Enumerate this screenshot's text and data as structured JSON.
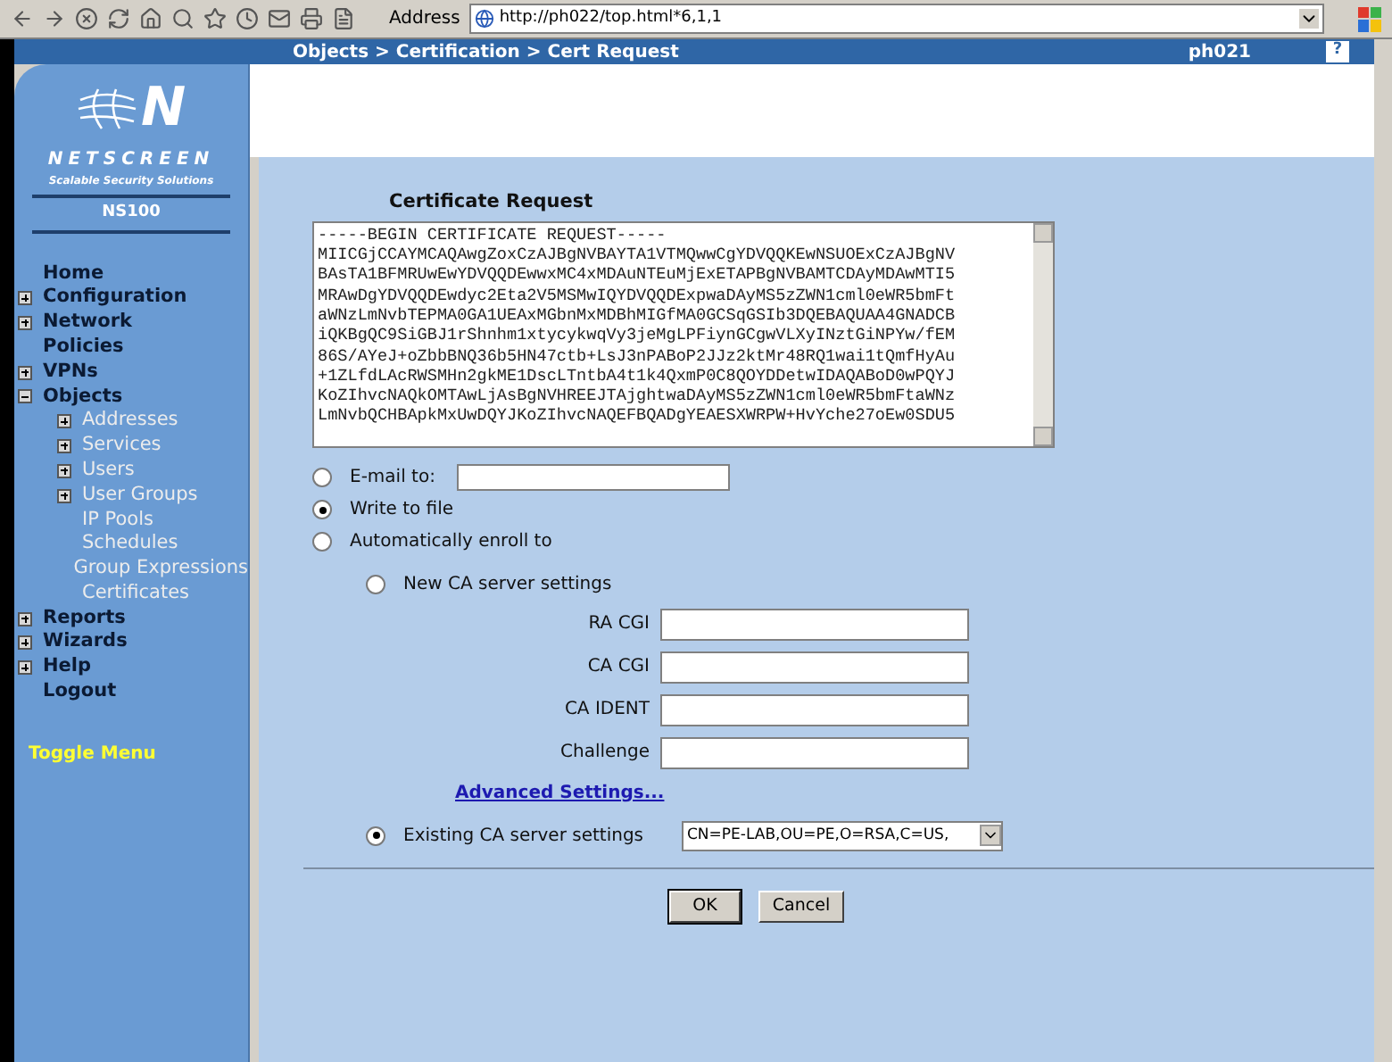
{
  "browser": {
    "address_label": "Address",
    "url": "http://ph022/top.html*6,1,1"
  },
  "header": {
    "breadcrumb": "Objects > Certification > Cert Request",
    "device": "ph021",
    "help": "?"
  },
  "sidebar": {
    "logo_mark": "N",
    "brand": "NETSCREEN",
    "tagline": "Scalable Security Solutions",
    "model": "NS100",
    "items": [
      {
        "label": "Home",
        "kind": "page"
      },
      {
        "label": "Configuration",
        "kind": "folder",
        "expanded": false
      },
      {
        "label": "Network",
        "kind": "folder",
        "expanded": false
      },
      {
        "label": "Policies",
        "kind": "page"
      },
      {
        "label": "VPNs",
        "kind": "folder",
        "expanded": false
      },
      {
        "label": "Objects",
        "kind": "folder",
        "expanded": true,
        "children": [
          {
            "label": "Addresses",
            "kind": "folder",
            "expanded": false
          },
          {
            "label": "Services",
            "kind": "folder",
            "expanded": false
          },
          {
            "label": "Users",
            "kind": "folder",
            "expanded": false
          },
          {
            "label": "User Groups",
            "kind": "folder",
            "expanded": false
          },
          {
            "label": "IP Pools",
            "kind": "page"
          },
          {
            "label": "Schedules",
            "kind": "page"
          },
          {
            "label": "Group Expressions",
            "kind": "page"
          },
          {
            "label": "Certificates",
            "kind": "page"
          }
        ]
      },
      {
        "label": "Reports",
        "kind": "folder",
        "expanded": false
      },
      {
        "label": "Wizards",
        "kind": "folder",
        "expanded": false
      },
      {
        "label": "Help",
        "kind": "folder",
        "expanded": false
      },
      {
        "label": "Logout",
        "kind": "page"
      }
    ],
    "toggle": "Toggle Menu"
  },
  "form": {
    "title": "Certificate Request",
    "request_lines": [
      "-----BEGIN CERTIFICATE REQUEST-----",
      "MIICGjCCAYMCAQAwgZoxCzAJBgNVBAYTA1VTMQwwCgYDVQQKEwNSUOExCzAJBgNV",
      "BAsTA1BFMRUwEwYDVQQDEwwxMC4xMDAuNTEuMjExETAPBgNVBAMTCDAyMDAwMTI5",
      "MRAwDgYDVQQDEwdyc2Eta2V5MSMwIQYDVQQDExpwaDAyMS5zZWN1cml0eWR5bmFt",
      "aWNzLmNvbTEPMA0GA1UEAxMGbnMxMDBhMIGfMA0GCSqGSIb3DQEBAQUAA4GNADCB",
      "iQKBgQC9SiGBJ1rShnhm1xtycykwqVy3jeMgLPFiynGCgwVLXyINztGiNPYw/fEM",
      "86S/AYeJ+oZbbBNQ36b5HN47ctb+LsJ3nPABoP2JJz2ktMr48RQ1wai1tQmfHyAu",
      "+1ZLfdLAcRWSMHn2gkME1DscLTntbA4t1k4QxmP0C8QOYDDetwIDAQABoD0wPQYJ",
      "KoZIhvcNAQkOMTAwLjAsBgNVHREEJTAjghtwaDAyMS5zZWN1cml0eWR5bmFtaWNz",
      "LmNvbQCHBApkMxUwDQYJKoZIhvcNAQEFBQADgYEAESXWRPW+HvYche27oEw0SDU5"
    ],
    "output_options": [
      {
        "label": "E-mail to:",
        "selected": false,
        "kind": "field"
      },
      {
        "label": "Write to file",
        "selected": true,
        "kind": "plain"
      },
      {
        "label": "Automatically enroll to",
        "selected": false,
        "kind": "plain"
      }
    ],
    "new_ca": {
      "label": "New CA server settings",
      "selected": false
    },
    "fields": [
      {
        "label": "RA CGI"
      },
      {
        "label": "CA CGI"
      },
      {
        "label": "CA IDENT"
      },
      {
        "label": "Challenge"
      }
    ],
    "advanced_link": "Advanced Settings...",
    "existing_ca": {
      "label": "Existing CA server settings",
      "selected": true,
      "value": "CN=PE-LAB,OU=PE,O=RSA,C=US,"
    },
    "buttons": [
      "OK",
      "Cancel"
    ]
  }
}
